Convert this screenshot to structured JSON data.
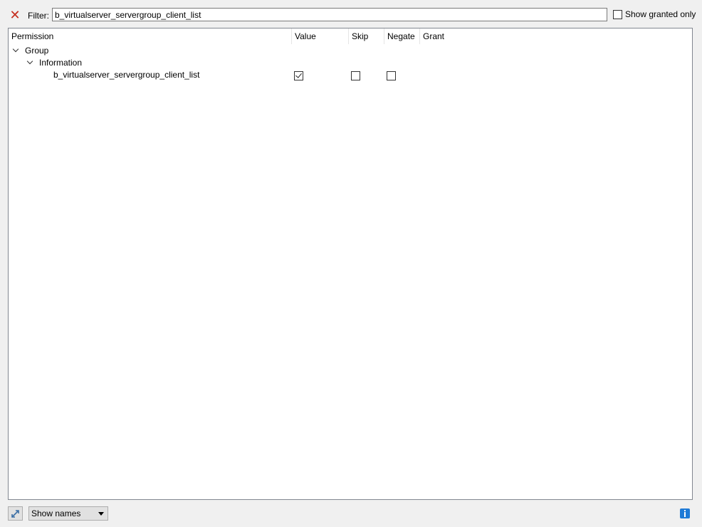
{
  "filter": {
    "label": "Filter:",
    "value": "b_virtualserver_servergroup_client_list",
    "clear_icon": "red-x"
  },
  "show_granted_only": {
    "label": "Show granted only",
    "checked": false
  },
  "tree": {
    "columns": [
      "Permission",
      "Value",
      "Skip",
      "Negate",
      "Grant"
    ],
    "rows": [
      {
        "label": "Group",
        "type": "group",
        "expanded": true
      },
      {
        "label": "Information",
        "type": "subgroup",
        "expanded": true
      },
      {
        "label": "b_virtualserver_servergroup_client_list",
        "type": "permission",
        "value": true,
        "skip": false,
        "negate": false
      }
    ]
  },
  "bottom": {
    "tool_icon": "expand-collapse-icon",
    "display_mode": "Show names",
    "info_icon": "info-icon",
    "accent": "#1e7ad6"
  }
}
